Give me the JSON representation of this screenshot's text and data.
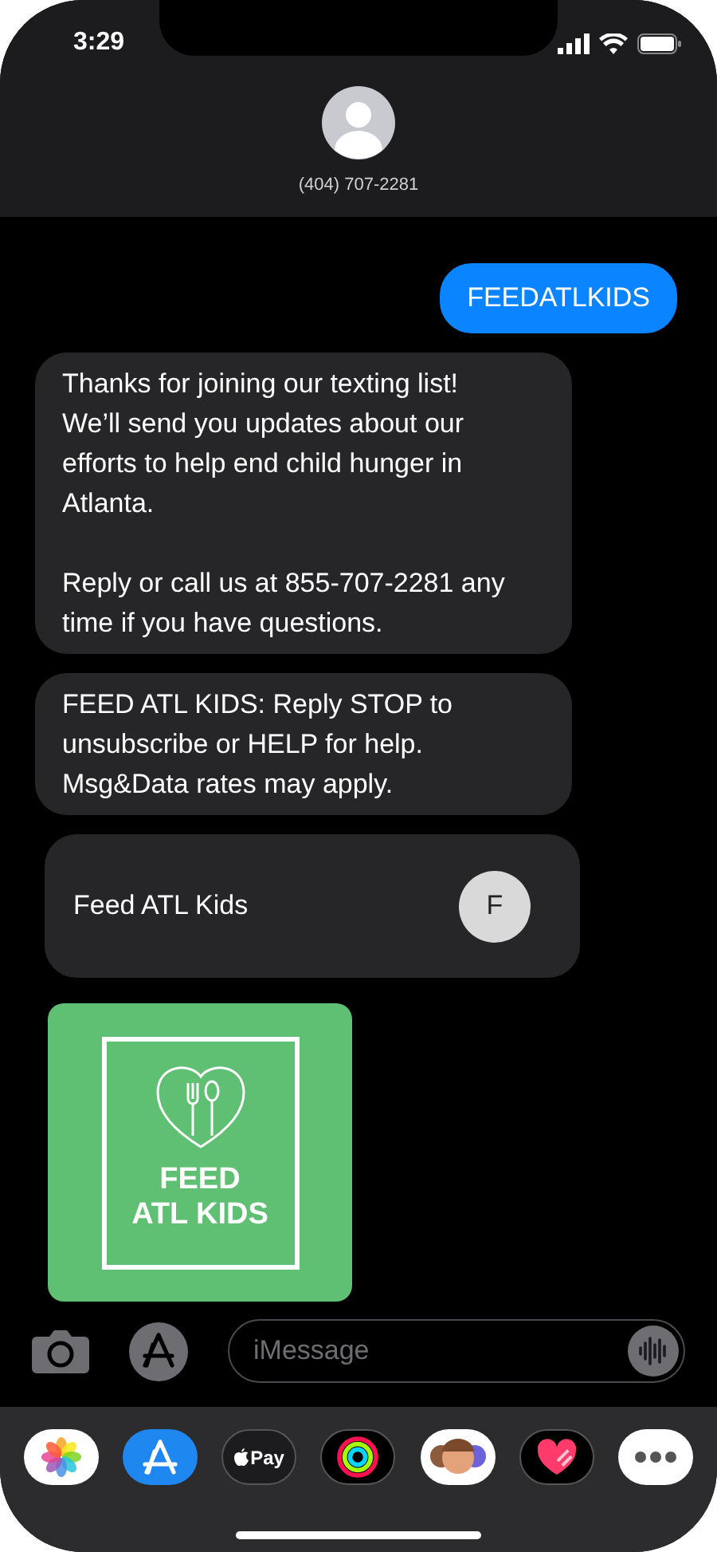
{
  "status_bar": {
    "time": "3:29"
  },
  "contact": {
    "number": "(404) 707-2281"
  },
  "messages": [
    {
      "kind": "sent",
      "paragraphs": [
        "FEEDATLKIDS"
      ]
    },
    {
      "kind": "received",
      "paragraphs": [
        "Thanks for joining our texting list! We’ll send you updates about our efforts to help end child hunger in Atlanta.",
        "Reply or call us at 855-707-2281 any time if you have questions."
      ]
    },
    {
      "kind": "received",
      "paragraphs": [
        "FEED ATL KIDS: Reply STOP to unsubscribe or HELP for help. Msg&Data rates may apply."
      ]
    },
    {
      "kind": "contact_card",
      "name": "Feed ATL Kids",
      "initial": "F"
    },
    {
      "kind": "image",
      "logo_lines": [
        "FEED",
        "ATL KIDS"
      ]
    }
  ],
  "compose": {
    "placeholder": "iMessage"
  },
  "app_drawer": [
    {
      "kind": "photos"
    },
    {
      "kind": "app_store"
    },
    {
      "kind": "apple_pay",
      "label": "Pay"
    },
    {
      "kind": "activity"
    },
    {
      "kind": "memoji"
    },
    {
      "kind": "heart"
    },
    {
      "kind": "more"
    }
  ]
}
